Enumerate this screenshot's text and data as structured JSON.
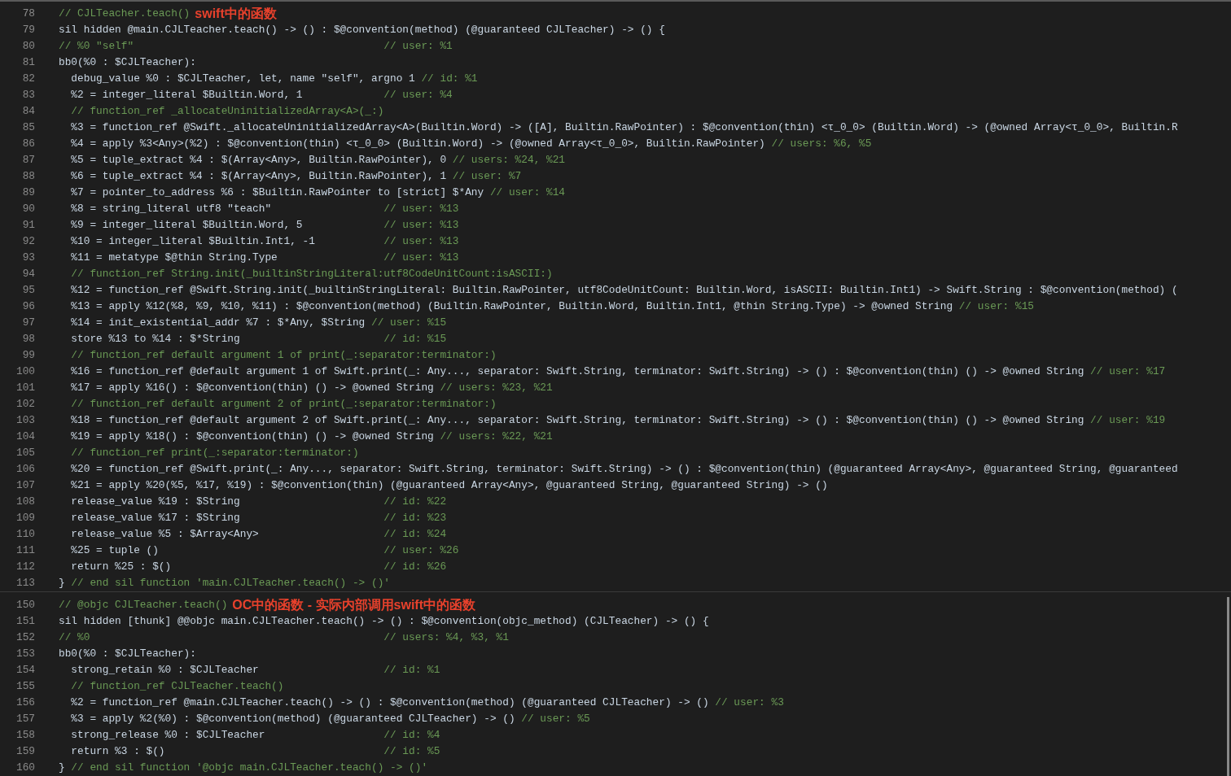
{
  "sections": [
    {
      "lines": [
        {
          "n": "78",
          "kind": "comment",
          "text": "// CJLTeacher.teach()",
          "annotation": "swift中的函数"
        },
        {
          "n": "79",
          "kind": "code",
          "text": "sil hidden @main.CJLTeacher.teach() -> () : $@convention(method) (@guaranteed CJLTeacher) -> () {"
        },
        {
          "n": "80",
          "kind": "comment",
          "text": "// %0 \"self\"",
          "comment": "// user: %1",
          "aligned": true
        },
        {
          "n": "81",
          "kind": "code",
          "text": "bb0(%0 : $CJLTeacher):"
        },
        {
          "n": "82",
          "kind": "code",
          "text": "  debug_value %0 : $CJLTeacher, let, name \"self\", argno 1",
          "comment": "// id: %1",
          "aligned": false
        },
        {
          "n": "83",
          "kind": "code",
          "text": "  %2 = integer_literal $Builtin.Word, 1",
          "comment": "// user: %4",
          "aligned": true
        },
        {
          "n": "84",
          "kind": "comment",
          "text": "  // function_ref _allocateUninitializedArray<A>(_:)"
        },
        {
          "n": "85",
          "kind": "code",
          "text": "  %3 = function_ref @Swift._allocateUninitializedArray<A>(Builtin.Word) -> ([A], Builtin.RawPointer) : $@convention(thin) <τ_0_0> (Builtin.Word) -> (@owned Array<τ_0_0>, Builtin.R"
        },
        {
          "n": "86",
          "kind": "code",
          "text": "  %4 = apply %3<Any>(%2) : $@convention(thin) <τ_0_0> (Builtin.Word) -> (@owned Array<τ_0_0>, Builtin.RawPointer)",
          "comment": "// users: %6, %5",
          "aligned": false
        },
        {
          "n": "87",
          "kind": "code",
          "text": "  %5 = tuple_extract %4 : $(Array<Any>, Builtin.RawPointer), 0",
          "comment": "// users: %24, %21",
          "aligned": false
        },
        {
          "n": "88",
          "kind": "code",
          "text": "  %6 = tuple_extract %4 : $(Array<Any>, Builtin.RawPointer), 1",
          "comment": "// user: %7",
          "aligned": false
        },
        {
          "n": "89",
          "kind": "code",
          "text": "  %7 = pointer_to_address %6 : $Builtin.RawPointer to [strict] $*Any",
          "comment": "// user: %14",
          "aligned": false
        },
        {
          "n": "90",
          "kind": "code",
          "text": "  %8 = string_literal utf8 \"teach\"",
          "comment": "// user: %13",
          "aligned": true
        },
        {
          "n": "91",
          "kind": "code",
          "text": "  %9 = integer_literal $Builtin.Word, 5",
          "comment": "// user: %13",
          "aligned": true
        },
        {
          "n": "92",
          "kind": "code",
          "text": "  %10 = integer_literal $Builtin.Int1, -1",
          "comment": "// user: %13",
          "aligned": true
        },
        {
          "n": "93",
          "kind": "code",
          "text": "  %11 = metatype $@thin String.Type",
          "comment": "// user: %13",
          "aligned": true
        },
        {
          "n": "94",
          "kind": "comment",
          "text": "  // function_ref String.init(_builtinStringLiteral:utf8CodeUnitCount:isASCII:)"
        },
        {
          "n": "95",
          "kind": "code",
          "text": "  %12 = function_ref @Swift.String.init(_builtinStringLiteral: Builtin.RawPointer, utf8CodeUnitCount: Builtin.Word, isASCII: Builtin.Int1) -> Swift.String : $@convention(method) ("
        },
        {
          "n": "96",
          "kind": "code",
          "text": "  %13 = apply %12(%8, %9, %10, %11) : $@convention(method) (Builtin.RawPointer, Builtin.Word, Builtin.Int1, @thin String.Type) -> @owned String",
          "comment": "// user: %15",
          "aligned": false
        },
        {
          "n": "97",
          "kind": "code",
          "text": "  %14 = init_existential_addr %7 : $*Any, $String",
          "comment": "// user: %15",
          "aligned": false
        },
        {
          "n": "98",
          "kind": "code",
          "text": "  store %13 to %14 : $*String",
          "comment": "// id: %15",
          "aligned": true
        },
        {
          "n": "99",
          "kind": "comment",
          "text": "  // function_ref default argument 1 of print(_:separator:terminator:)"
        },
        {
          "n": "100",
          "kind": "code",
          "text": "  %16 = function_ref @default argument 1 of Swift.print(_: Any..., separator: Swift.String, terminator: Swift.String) -> () : $@convention(thin) () -> @owned String",
          "comment": "// user: %17",
          "aligned": false
        },
        {
          "n": "101",
          "kind": "code",
          "text": "  %17 = apply %16() : $@convention(thin) () -> @owned String",
          "comment": "// users: %23, %21",
          "aligned": false
        },
        {
          "n": "102",
          "kind": "comment",
          "text": "  // function_ref default argument 2 of print(_:separator:terminator:)"
        },
        {
          "n": "103",
          "kind": "code",
          "text": "  %18 = function_ref @default argument 2 of Swift.print(_: Any..., separator: Swift.String, terminator: Swift.String) -> () : $@convention(thin) () -> @owned String",
          "comment": "// user: %19",
          "aligned": false
        },
        {
          "n": "104",
          "kind": "code",
          "text": "  %19 = apply %18() : $@convention(thin) () -> @owned String",
          "comment": "// users: %22, %21",
          "aligned": false
        },
        {
          "n": "105",
          "kind": "comment",
          "text": "  // function_ref print(_:separator:terminator:)"
        },
        {
          "n": "106",
          "kind": "code",
          "text": "  %20 = function_ref @Swift.print(_: Any..., separator: Swift.String, terminator: Swift.String) -> () : $@convention(thin) (@guaranteed Array<Any>, @guaranteed String, @guaranteed"
        },
        {
          "n": "107",
          "kind": "code",
          "text": "  %21 = apply %20(%5, %17, %19) : $@convention(thin) (@guaranteed Array<Any>, @guaranteed String, @guaranteed String) -> ()"
        },
        {
          "n": "108",
          "kind": "code",
          "text": "  release_value %19 : $String",
          "comment": "// id: %22",
          "aligned": true
        },
        {
          "n": "109",
          "kind": "code",
          "text": "  release_value %17 : $String",
          "comment": "// id: %23",
          "aligned": true
        },
        {
          "n": "110",
          "kind": "code",
          "text": "  release_value %5 : $Array<Any>",
          "comment": "// id: %24",
          "aligned": true
        },
        {
          "n": "111",
          "kind": "code",
          "text": "  %25 = tuple ()",
          "comment": "// user: %26",
          "aligned": true
        },
        {
          "n": "112",
          "kind": "code",
          "text": "  return %25 : $()",
          "comment": "// id: %26",
          "aligned": true
        },
        {
          "n": "113",
          "kind": "code",
          "text": "}",
          "comment": "// end sil function 'main.CJLTeacher.teach() -> ()'",
          "aligned": false
        }
      ]
    },
    {
      "lines": [
        {
          "n": "150",
          "kind": "comment",
          "text": "// @objc CJLTeacher.teach()",
          "annotation": "OC中的函数 - 实际内部调用swift中的函数"
        },
        {
          "n": "151",
          "kind": "code",
          "text": "sil hidden [thunk] @@objc main.CJLTeacher.teach() -> () : $@convention(objc_method) (CJLTeacher) -> () {"
        },
        {
          "n": "152",
          "kind": "comment",
          "text": "// %0",
          "comment": "// users: %4, %3, %1",
          "aligned": true
        },
        {
          "n": "153",
          "kind": "code",
          "text": "bb0(%0 : $CJLTeacher):"
        },
        {
          "n": "154",
          "kind": "code",
          "text": "  strong_retain %0 : $CJLTeacher",
          "comment": "// id: %1",
          "aligned": true
        },
        {
          "n": "155",
          "kind": "comment",
          "text": "  // function_ref CJLTeacher.teach()"
        },
        {
          "n": "156",
          "kind": "code",
          "text": "  %2 = function_ref @main.CJLTeacher.teach() -> () : $@convention(method) (@guaranteed CJLTeacher) -> ()",
          "comment": "// user: %3",
          "aligned": false
        },
        {
          "n": "157",
          "kind": "code",
          "text": "  %3 = apply %2(%0) : $@convention(method) (@guaranteed CJLTeacher) -> ()",
          "comment": "// user: %5",
          "aligned": false
        },
        {
          "n": "158",
          "kind": "code",
          "text": "  strong_release %0 : $CJLTeacher",
          "comment": "// id: %4",
          "aligned": true
        },
        {
          "n": "159",
          "kind": "code",
          "text": "  return %3 : $()",
          "comment": "// id: %5",
          "aligned": true
        },
        {
          "n": "160",
          "kind": "code",
          "text": "}",
          "comment": "// end sil function '@objc main.CJLTeacher.teach() -> ()'",
          "aligned": false
        }
      ]
    }
  ]
}
